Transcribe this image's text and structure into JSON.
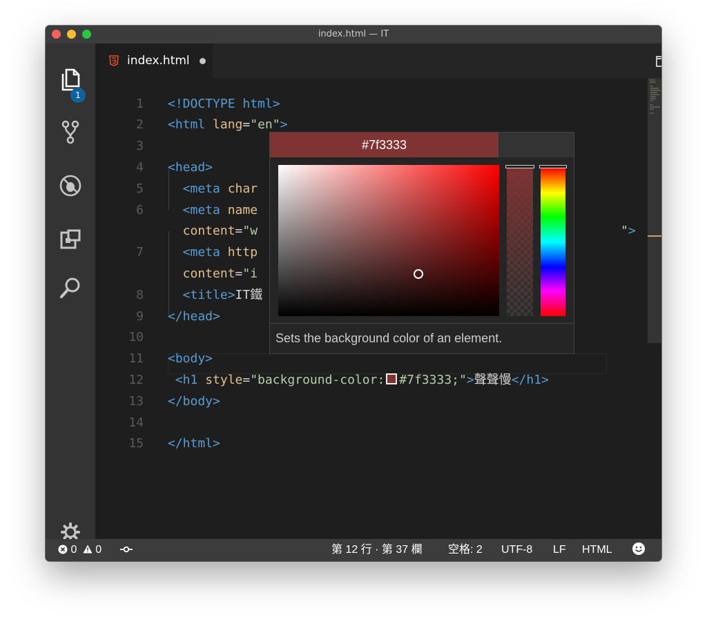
{
  "window": {
    "title": "index.html — IT"
  },
  "activity": {
    "explorer_badge": "1"
  },
  "tab": {
    "label": "index.html"
  },
  "editor": {
    "lines": [
      {
        "num": "1",
        "segments": [
          {
            "c": "tag",
            "t": "<!DOCTYPE html>"
          }
        ]
      },
      {
        "num": "2",
        "segments": [
          {
            "c": "tag",
            "t": "<html "
          },
          {
            "c": "attr",
            "t": "lang"
          },
          {
            "c": "txt",
            "t": "="
          },
          {
            "c": "str",
            "t": "\"en\""
          },
          {
            "c": "tag",
            "t": ">"
          }
        ]
      },
      {
        "num": "3",
        "segments": []
      },
      {
        "num": "4",
        "segments": [
          {
            "c": "tag",
            "t": "<head>"
          }
        ]
      },
      {
        "num": "5",
        "segments": [
          {
            "c": "tag",
            "t": "  <meta "
          },
          {
            "c": "attr",
            "t": "char"
          }
        ]
      },
      {
        "num": "6",
        "segments": [
          {
            "c": "tag",
            "t": "  <meta "
          },
          {
            "c": "attr",
            "t": "name"
          }
        ]
      },
      {
        "num": "",
        "segments": [
          {
            "c": "attr",
            "t": "  content"
          },
          {
            "c": "txt",
            "t": "="
          },
          {
            "c": "str",
            "t": "\"w"
          }
        ],
        "tail": "\">"
      },
      {
        "num": "7",
        "segments": [
          {
            "c": "tag",
            "t": "  <meta "
          },
          {
            "c": "attr",
            "t": "http"
          }
        ]
      },
      {
        "num": "",
        "segments": [
          {
            "c": "attr",
            "t": "  content"
          },
          {
            "c": "txt",
            "t": "="
          },
          {
            "c": "str",
            "t": "\"i"
          }
        ]
      },
      {
        "num": "8",
        "segments": [
          {
            "c": "tag",
            "t": "  <title>"
          },
          {
            "c": "txt",
            "t": "IT鐵"
          }
        ]
      },
      {
        "num": "9",
        "segments": [
          {
            "c": "tag",
            "t": "</head>"
          }
        ]
      },
      {
        "num": "10",
        "segments": []
      },
      {
        "num": "11",
        "segments": [
          {
            "c": "tag",
            "t": "<body>"
          }
        ]
      },
      {
        "num": "12",
        "segments": [
          {
            "c": "tag",
            "t": " <h1 "
          },
          {
            "c": "attr",
            "t": "style"
          },
          {
            "c": "txt",
            "t": "="
          },
          {
            "c": "str",
            "t": "\"background-color:"
          },
          {
            "c": "swatch",
            "t": ""
          },
          {
            "c": "str",
            "t": "#7f3333;\""
          },
          {
            "c": "tag",
            "t": ">"
          },
          {
            "c": "txt",
            "t": "聲聲慢"
          },
          {
            "c": "tag",
            "t": "</h1>"
          }
        ]
      },
      {
        "num": "13",
        "segments": [
          {
            "c": "tag",
            "t": "</body>"
          }
        ]
      },
      {
        "num": "14",
        "segments": []
      },
      {
        "num": "15",
        "segments": [
          {
            "c": "tag",
            "t": "</html>"
          }
        ]
      }
    ]
  },
  "color_picker": {
    "hex": "#7f3333",
    "color": "#7f3333",
    "description": "Sets the background color of an element."
  },
  "statusbar": {
    "errors": "0",
    "warnings": "0",
    "position": "第 12 行 · 第 37 欄",
    "indent": "空格: 2",
    "encoding": "UTF-8",
    "eol": "LF",
    "language": "HTML"
  },
  "colors": {
    "activity_bar": "#333333",
    "editor_bg": "#1e1e1e",
    "tag": "#569cd6",
    "attribute": "#e2c08d",
    "string": "#b5cea8",
    "status_bar": "#3c3c3c"
  },
  "icons": [
    "explorer-icon",
    "source-control-icon",
    "debug-icon",
    "extensions-icon",
    "search-icon",
    "gear-icon",
    "html5-icon",
    "split-editor-icon",
    "more-icon",
    "error-icon",
    "warning-icon",
    "live-share-icon",
    "smiley-icon"
  ]
}
